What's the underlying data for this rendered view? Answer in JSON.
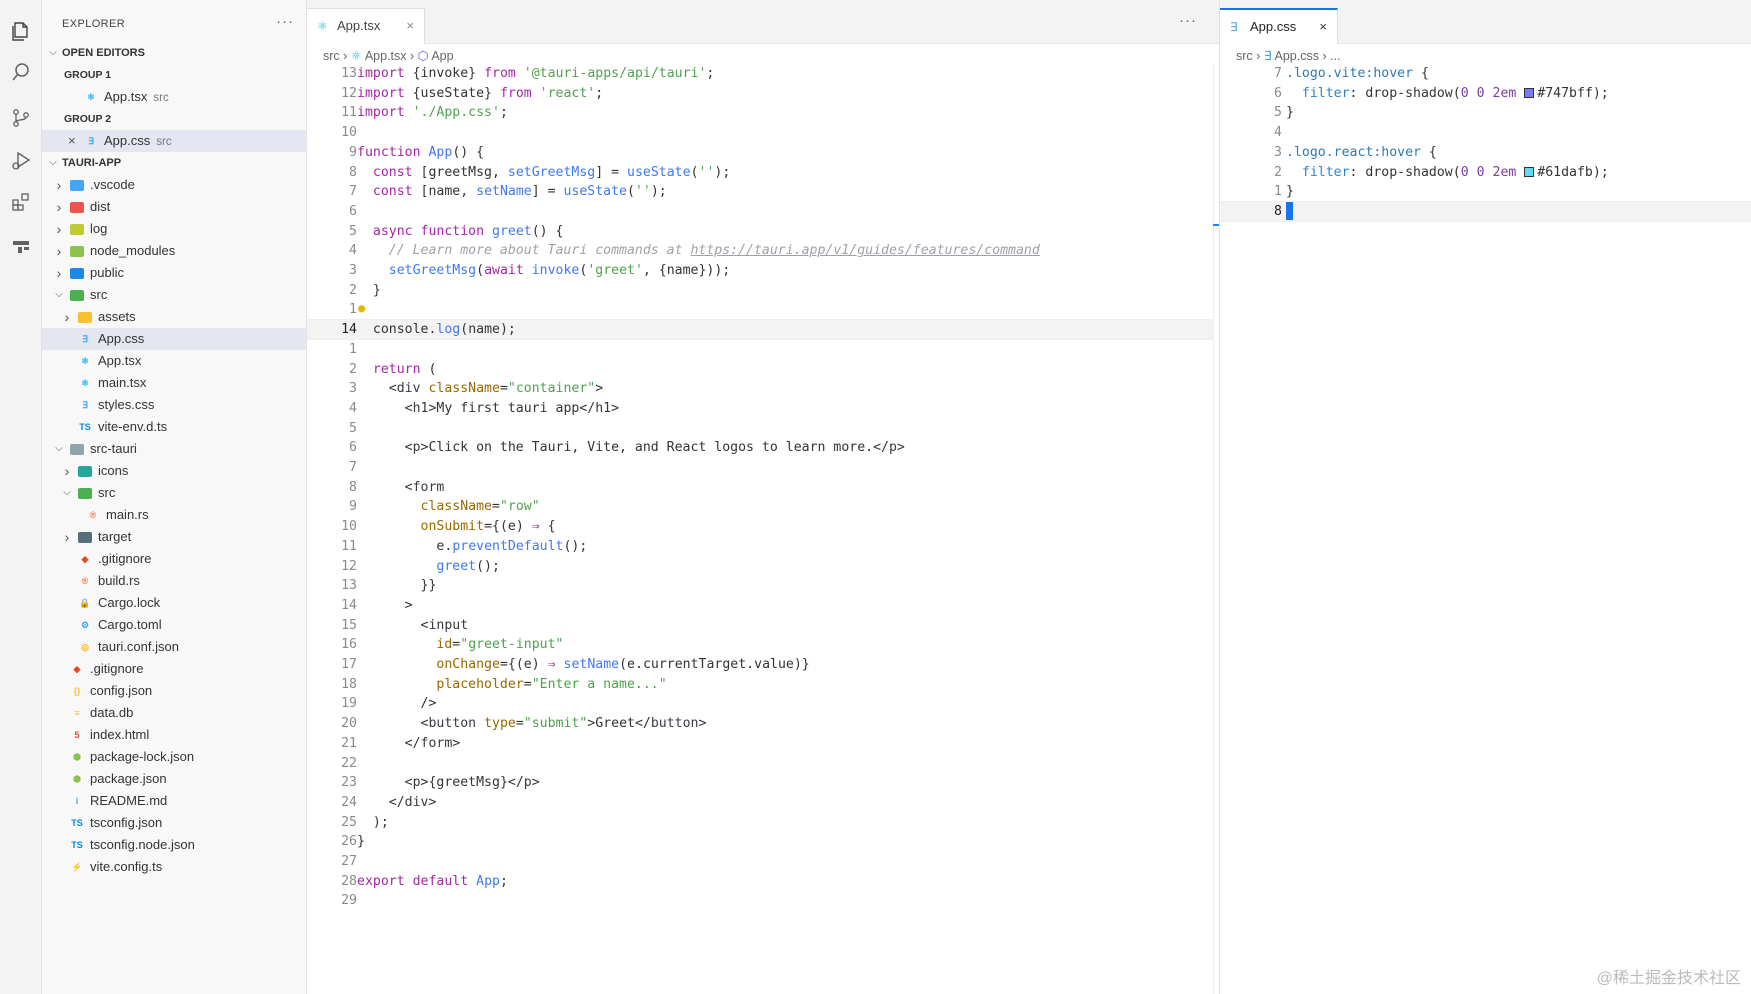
{
  "explorer": {
    "title": "EXPLORER",
    "more": "···",
    "open_editors": {
      "label": "OPEN EDITORS",
      "groups": [
        {
          "label": "GROUP 1",
          "file": "App.tsx",
          "desc": "src"
        },
        {
          "label": "GROUP 2",
          "file": "App.css",
          "desc": "src"
        }
      ]
    },
    "project": {
      "label": "TAURI-APP"
    },
    "tree": [
      {
        "name": ".vscode",
        "depth": 1,
        "type": "folder",
        "chev": "closed",
        "icon": "folder-vscode",
        "color": "#42a5f5"
      },
      {
        "name": "dist",
        "depth": 1,
        "type": "folder",
        "chev": "closed",
        "icon": "folder-dist",
        "color": "#ef5350"
      },
      {
        "name": "log",
        "depth": 1,
        "type": "folder",
        "chev": "closed",
        "icon": "folder-log",
        "color": "#c0ca33"
      },
      {
        "name": "node_modules",
        "depth": 1,
        "type": "folder",
        "chev": "closed",
        "icon": "folder-node",
        "color": "#8bc34a"
      },
      {
        "name": "public",
        "depth": 1,
        "type": "folder",
        "chev": "closed",
        "icon": "folder-public",
        "color": "#1e88e5"
      },
      {
        "name": "src",
        "depth": 1,
        "type": "folder",
        "chev": "open",
        "icon": "folder-src",
        "color": "#4caf50"
      },
      {
        "name": "assets",
        "depth": 2,
        "type": "folder",
        "chev": "closed",
        "icon": "folder-assets",
        "color": "#fbc02d"
      },
      {
        "name": "App.css",
        "depth": 2,
        "type": "file",
        "icon": "css-icon",
        "color": "#42a5f5",
        "selected": true
      },
      {
        "name": "App.tsx",
        "depth": 2,
        "type": "file",
        "icon": "react-icon",
        "color": "#29b6f6"
      },
      {
        "name": "main.tsx",
        "depth": 2,
        "type": "file",
        "icon": "react-icon",
        "color": "#29b6f6"
      },
      {
        "name": "styles.css",
        "depth": 2,
        "type": "file",
        "icon": "css-icon",
        "color": "#42a5f5"
      },
      {
        "name": "vite-env.d.ts",
        "depth": 2,
        "type": "file",
        "icon": "ts-def-icon",
        "color": "#0288d1"
      },
      {
        "name": "src-tauri",
        "depth": 1,
        "type": "folder",
        "chev": "open",
        "icon": "folder-plain",
        "color": "#90a4ae"
      },
      {
        "name": "icons",
        "depth": 2,
        "type": "folder",
        "chev": "closed",
        "icon": "folder-icons",
        "color": "#26a69a"
      },
      {
        "name": "src",
        "depth": 2,
        "type": "folder",
        "chev": "open",
        "icon": "folder-src",
        "color": "#4caf50"
      },
      {
        "name": "main.rs",
        "depth": 3,
        "type": "file",
        "icon": "rust-icon",
        "color": "#ff7043"
      },
      {
        "name": "target",
        "depth": 2,
        "type": "folder",
        "chev": "closed",
        "icon": "folder-target",
        "color": "#546e7a"
      },
      {
        "name": ".gitignore",
        "depth": 2,
        "type": "file",
        "icon": "git-icon",
        "color": "#e64a19"
      },
      {
        "name": "build.rs",
        "depth": 2,
        "type": "file",
        "icon": "rust-icon",
        "color": "#ff7043"
      },
      {
        "name": "Cargo.lock",
        "depth": 2,
        "type": "file",
        "icon": "lock-icon",
        "color": "#fbc02d"
      },
      {
        "name": "Cargo.toml",
        "depth": 2,
        "type": "file",
        "icon": "gear-icon",
        "color": "#42a5f5"
      },
      {
        "name": "tauri.conf.json",
        "depth": 2,
        "type": "file",
        "icon": "tauri-icon",
        "color": "#ffb300"
      },
      {
        "name": ".gitignore",
        "depth": 1,
        "type": "file",
        "icon": "git-icon",
        "color": "#e64a19"
      },
      {
        "name": "config.json",
        "depth": 1,
        "type": "file",
        "icon": "json-icon",
        "color": "#fbc02d"
      },
      {
        "name": "data.db",
        "depth": 1,
        "type": "file",
        "icon": "database-icon",
        "color": "#fbc02d"
      },
      {
        "name": "index.html",
        "depth": 1,
        "type": "file",
        "icon": "html-icon",
        "color": "#e44d26"
      },
      {
        "name": "package-lock.json",
        "depth": 1,
        "type": "file",
        "icon": "npm-icon",
        "color": "#8bc34a"
      },
      {
        "name": "package.json",
        "depth": 1,
        "type": "file",
        "icon": "npm-icon",
        "color": "#8bc34a"
      },
      {
        "name": "README.md",
        "depth": 1,
        "type": "file",
        "icon": "info-icon",
        "color": "#42a5f5"
      },
      {
        "name": "tsconfig.json",
        "depth": 1,
        "type": "file",
        "icon": "tsconfig-icon",
        "color": "#0288d1"
      },
      {
        "name": "tsconfig.node.json",
        "depth": 1,
        "type": "file",
        "icon": "tsconfig-icon",
        "color": "#0288d1"
      },
      {
        "name": "vite.config.ts",
        "depth": 1,
        "type": "file",
        "icon": "vite-icon",
        "color": "#ffca28"
      }
    ]
  },
  "editor_left": {
    "tab": {
      "label": "App.tsx",
      "close": "×"
    },
    "more": "···",
    "breadcrumb": [
      "src",
      "App.tsx",
      "App"
    ],
    "lines": [
      {
        "n": "13",
        "html": "<span class='k'>import</span> <span class='n'>{invoke}</span> <span class='k'>from</span> <span class='s'>'@tauri-apps/api/tauri'</span>;"
      },
      {
        "n": "12",
        "html": "<span class='k'>import</span> <span class='n'>{useState}</span> <span class='k'>from</span> <span class='s'>'react'</span>;"
      },
      {
        "n": "11",
        "html": "<span class='k'>import</span> <span class='s'>'./App.css'</span>;"
      },
      {
        "n": "10",
        "html": ""
      },
      {
        "n": "9",
        "html": "<span class='k'>function</span> <span class='f'>App</span>() {"
      },
      {
        "n": "8",
        "html": "  <span class='k'>const</span> [<span class='n'>greetMsg</span>, <span class='f'>setGreetMsg</span>] = <span class='f'>useState</span>(<span class='s'>''</span>);"
      },
      {
        "n": "7",
        "html": "  <span class='k'>const</span> [<span class='n'>name</span>, <span class='f'>setName</span>] = <span class='f'>useState</span>(<span class='s'>''</span>);"
      },
      {
        "n": "6",
        "html": ""
      },
      {
        "n": "5",
        "html": "  <span class='k'>async</span> <span class='k'>function</span> <span class='f'>greet</span>() {"
      },
      {
        "n": "4",
        "html": "    <span class='c'>// Learn more about Tauri commands at <span class='u'>https://tauri.app/v1/guides/features/command</span></span>"
      },
      {
        "n": "3",
        "html": "    <span class='f'>setGreetMsg</span>(<span class='k'>await</span> <span class='f'>invoke</span>(<span class='s'>'greet'</span>, {<span class='n'>name</span>}));"
      },
      {
        "n": "2",
        "html": "  }"
      },
      {
        "n": "1",
        "html": ""
      },
      {
        "n": "14",
        "html": "  <span class='n'>console</span>.<span class='f'>log</span>(<span class='n'>name</span>);",
        "current": true
      },
      {
        "n": "1",
        "html": ""
      },
      {
        "n": "2",
        "html": "  <span class='k'>return</span> ("
      },
      {
        "n": "3",
        "html": "    &lt;<span class='tag'>div</span> <span class='at'>className</span>=<span class='s'>\"container\"</span>&gt;"
      },
      {
        "n": "4",
        "html": "      &lt;<span class='tag'>h1</span>&gt;My first tauri app&lt;/<span class='tag'>h1</span>&gt;"
      },
      {
        "n": "5",
        "html": ""
      },
      {
        "n": "6",
        "html": "      &lt;<span class='tag'>p</span>&gt;Click on the Tauri, Vite, and React logos to learn more.&lt;/<span class='tag'>p</span>&gt;"
      },
      {
        "n": "7",
        "html": ""
      },
      {
        "n": "8",
        "html": "      &lt;<span class='tag'>form</span>"
      },
      {
        "n": "9",
        "html": "        <span class='at'>className</span>=<span class='s'>\"row\"</span>"
      },
      {
        "n": "10",
        "html": "        <span class='at'>onSubmit</span>={(<span class='n'>e</span>) <span class='k'>⇒</span> {"
      },
      {
        "n": "11",
        "html": "          <span class='n'>e</span>.<span class='f'>preventDefault</span>();"
      },
      {
        "n": "12",
        "html": "          <span class='f'>greet</span>();"
      },
      {
        "n": "13",
        "html": "        }}"
      },
      {
        "n": "14",
        "html": "      &gt;"
      },
      {
        "n": "15",
        "html": "        &lt;<span class='tag'>input</span>"
      },
      {
        "n": "16",
        "html": "          <span class='at'>id</span>=<span class='s'>\"greet-input\"</span>"
      },
      {
        "n": "17",
        "html": "          <span class='at'>onChange</span>={(<span class='n'>e</span>) <span class='k'>⇒</span> <span class='f'>setName</span>(<span class='n'>e</span>.<span class='n'>currentTarget</span>.<span class='n'>value</span>)}"
      },
      {
        "n": "18",
        "html": "          <span class='at'>placeholder</span>=<span class='s'>\"Enter a name...\"</span>"
      },
      {
        "n": "19",
        "html": "        /&gt;"
      },
      {
        "n": "20",
        "html": "        &lt;<span class='tag'>button</span> <span class='at'>type</span>=<span class='s'>\"submit\"</span>&gt;Greet&lt;/<span class='tag'>button</span>&gt;"
      },
      {
        "n": "21",
        "html": "      &lt;/<span class='tag'>form</span>&gt;"
      },
      {
        "n": "22",
        "html": ""
      },
      {
        "n": "23",
        "html": "      &lt;<span class='tag'>p</span>&gt;{<span class='n'>greetMsg</span>}&lt;/<span class='tag'>p</span>&gt;"
      },
      {
        "n": "24",
        "html": "    &lt;/<span class='tag'>div</span>&gt;"
      },
      {
        "n": "25",
        "html": "  );"
      },
      {
        "n": "26",
        "html": "}"
      },
      {
        "n": "27",
        "html": ""
      },
      {
        "n": "28",
        "html": "<span class='k'>export</span> <span class='k'>default</span> <span class='f'>App</span>;"
      },
      {
        "n": "29",
        "html": ""
      }
    ]
  },
  "editor_right": {
    "tab": {
      "label": "App.css",
      "close": "×"
    },
    "breadcrumb": [
      "src",
      "App.css",
      "..."
    ],
    "lines": [
      {
        "n": "7",
        "html": "<span class='sel-css'>.logo.vite:hover</span> {"
      },
      {
        "n": "6",
        "html": "  <span class='prop'>filter</span>: drop-shadow(<span class='num'>0</span> <span class='num'>0</span> <span class='num'>2em</span> <span class='sw' style='background:#747bff'></span>#747bff);"
      },
      {
        "n": "5",
        "html": "}"
      },
      {
        "n": "4",
        "html": ""
      },
      {
        "n": "3",
        "html": "<span class='sel-css'>.logo.react:hover</span> {"
      },
      {
        "n": "2",
        "html": "  <span class='prop'>filter</span>: drop-shadow(<span class='num'>0</span> <span class='num'>0</span> <span class='num'>2em</span> <span class='sw' style='background:#61dafb'></span>#61dafb);"
      },
      {
        "n": "1",
        "html": "}"
      },
      {
        "n": "8",
        "html": "",
        "current": true
      }
    ]
  },
  "watermark": "@稀土掘金技术社区"
}
